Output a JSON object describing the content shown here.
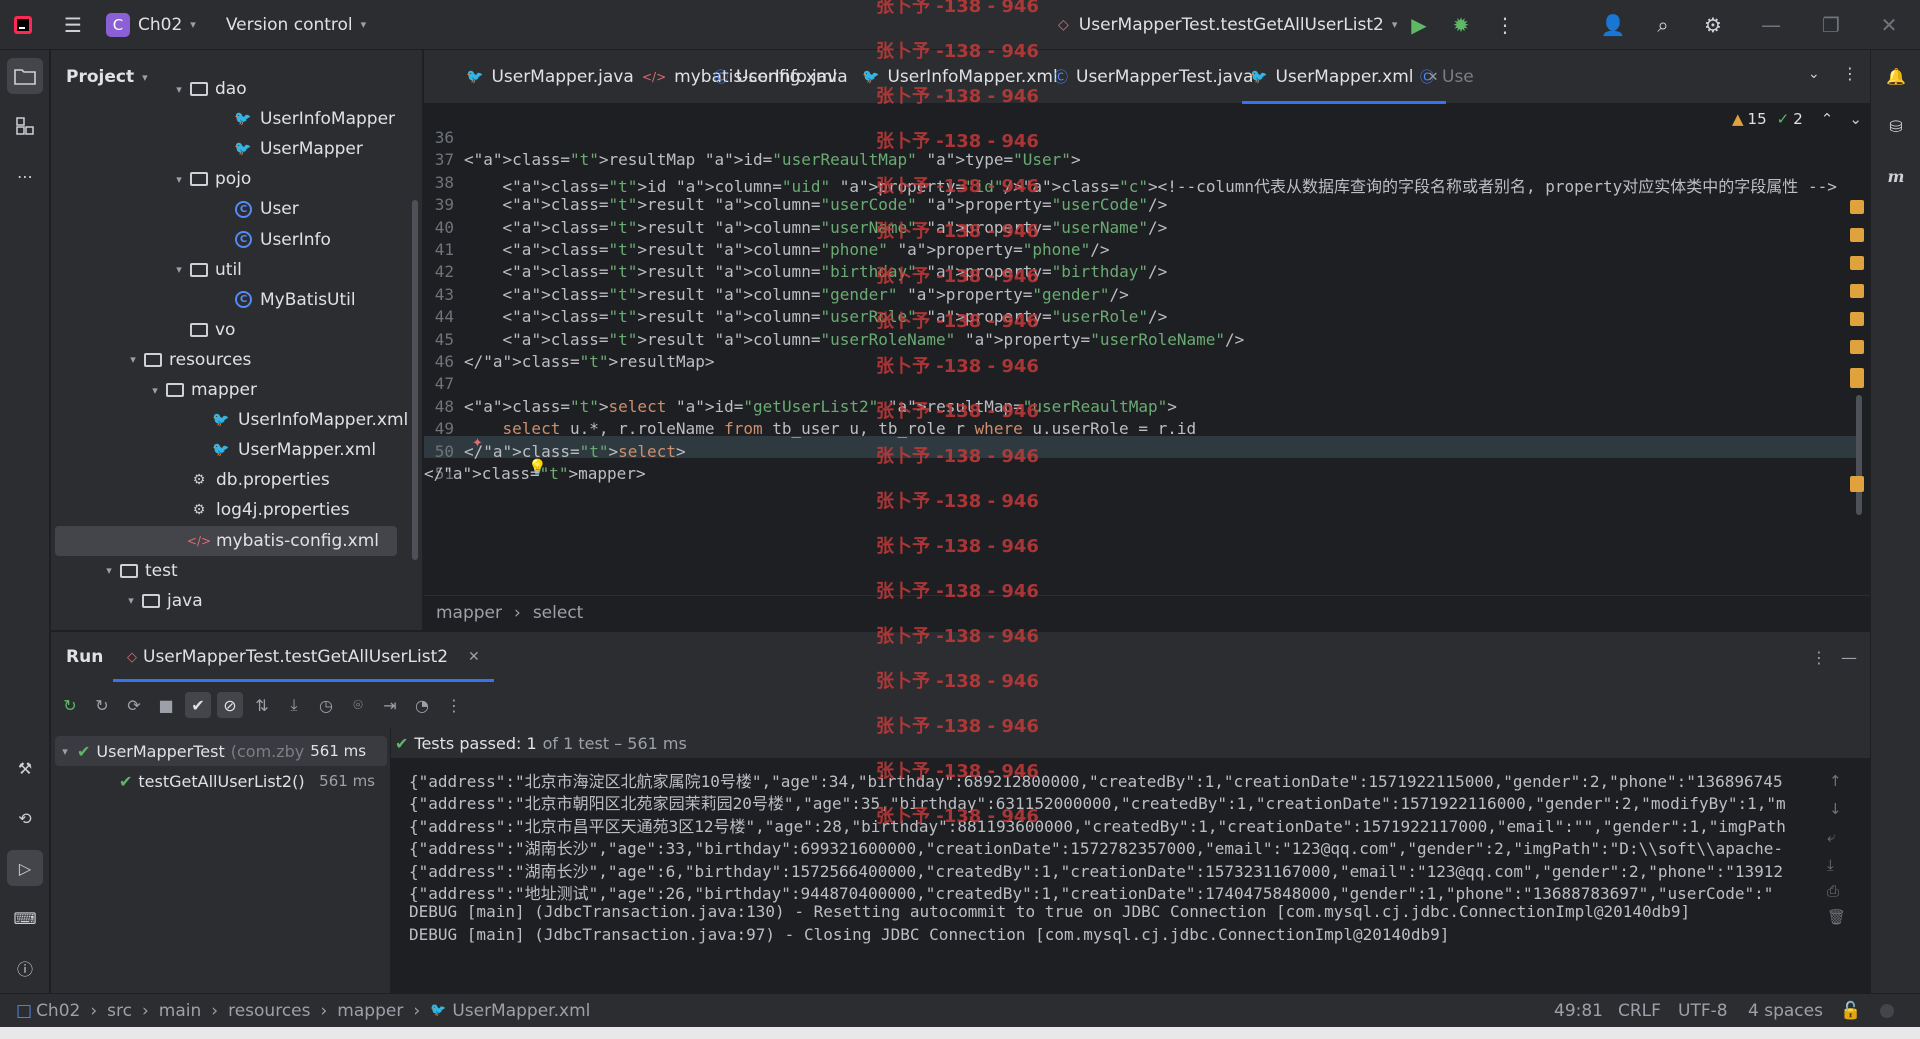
{
  "titlebar": {
    "project_initial": "C",
    "project_name": "Ch02",
    "vcs_label": "Version control",
    "run_config": "UserMapperTest.testGetAllUserList2"
  },
  "project_pane": {
    "title": "Project",
    "items": [
      {
        "label": "dao",
        "type": "package"
      },
      {
        "label": "UserInfoMapper",
        "type": "mapper"
      },
      {
        "label": "UserMapper",
        "type": "mapper"
      },
      {
        "label": "pojo",
        "type": "package"
      },
      {
        "label": "User",
        "type": "class"
      },
      {
        "label": "UserInfo",
        "type": "class"
      },
      {
        "label": "util",
        "type": "package"
      },
      {
        "label": "MyBatisUtil",
        "type": "class"
      },
      {
        "label": "vo",
        "type": "package"
      },
      {
        "label": "resources",
        "type": "folder"
      },
      {
        "label": "mapper",
        "type": "folder"
      },
      {
        "label": "UserInfoMapper.xml",
        "type": "mapper-xml"
      },
      {
        "label": "UserMapper.xml",
        "type": "mapper-xml"
      },
      {
        "label": "db.properties",
        "type": "properties"
      },
      {
        "label": "log4j.properties",
        "type": "properties"
      },
      {
        "label": "mybatis-config.xml",
        "type": "xml",
        "selected": true
      },
      {
        "label": "test",
        "type": "folder"
      },
      {
        "label": "java",
        "type": "folder"
      }
    ]
  },
  "editor": {
    "tabs": [
      {
        "label": "UserMapper.java",
        "icon": "mapper-icon"
      },
      {
        "label": "mybatis-config.xml",
        "icon": "xml-icon"
      },
      {
        "label": "UserInfo.java",
        "icon": "class-icon"
      },
      {
        "label": "UserInfoMapper.xml",
        "icon": "mapper-icon"
      },
      {
        "label": "UserMapperTest.java",
        "icon": "class-icon"
      },
      {
        "label": "UserMapper.xml",
        "icon": "mapper-icon",
        "active": true
      },
      {
        "label": "Use",
        "icon": "class-icon"
      }
    ],
    "warnings": "15",
    "weak_warnings": "2",
    "line_numbers": [
      "36",
      "37",
      "38",
      "39",
      "40",
      "41",
      "42",
      "43",
      "44",
      "45",
      "46",
      "47",
      "48",
      "49",
      "50",
      "51"
    ],
    "lines": [
      "",
      "<resultMap id=\"userReaultMap\" type=\"User\">",
      "    <id column=\"uid\" property=\"id\"/><!--column代表从数据库查询的字段名称或者别名, property对应实体类中的字段属性 -->",
      "    <result column=\"userCode\" property=\"userCode\"/>",
      "    <result column=\"userName\" property=\"userName\"/>",
      "    <result column=\"phone\" property=\"phone\"/>",
      "    <result column=\"birthday\" property=\"birthday\"/>",
      "    <result column=\"gender\" property=\"gender\"/>",
      "    <result column=\"userRole\" property=\"userRole\"/>",
      "    <result column=\"userRoleName\" property=\"userRoleName\"/>",
      "</resultMap>",
      "",
      "<select id=\"getUserList2\" resultMap=\"userReaultMap\">",
      "    select u.*, r.roleName from tb_user u, tb_role r where u.userRole = r.id",
      "</select>",
      "</mapper>"
    ],
    "breadcrumbs": [
      "mapper",
      "select"
    ]
  },
  "run_panel": {
    "title": "Run",
    "tab_label": "UserMapperTest.testGetAllUserList2",
    "tests": [
      {
        "name": "UserMapperTest",
        "pkg": "(com.zby",
        "time": "561 ms"
      },
      {
        "name": "testGetAllUserList2()",
        "pkg": "",
        "time": "561 ms"
      }
    ],
    "summary_bold": "Tests passed: 1",
    "summary_rest": "of 1 test – 561 ms",
    "console": [
      "{\"address\":\"北京市海淀区北航家属院10号楼\",\"age\":34,\"birthday\":689212800000,\"createdBy\":1,\"creationDate\":1571922115000,\"gender\":2,\"phone\":\"136896745",
      "{\"address\":\"北京市朝阳区北苑家园茉莉园20号楼\",\"age\":35,\"birthday\":631152000000,\"createdBy\":1,\"creationDate\":1571922116000,\"gender\":2,\"modifyBy\":1,\"m",
      "{\"address\":\"北京市昌平区天通苑3区12号楼\",\"age\":28,\"birthday\":881193600000,\"createdBy\":1,\"creationDate\":1571922117000,\"email\":\"\",\"gender\":1,\"imgPath",
      "{\"address\":\"湖南长沙\",\"age\":33,\"birthday\":699321600000,\"creationDate\":1572782357000,\"email\":\"123@qq.com\",\"gender\":2,\"imgPath\":\"D:\\\\soft\\\\apache-",
      "{\"address\":\"湖南长沙\",\"age\":6,\"birthday\":1572566400000,\"createdBy\":1,\"creationDate\":1573231167000,\"email\":\"123@qq.com\",\"gender\":2,\"phone\":\"13912",
      "{\"address\":\"地址测试\",\"age\":26,\"birthday\":944870400000,\"createdBy\":1,\"creationDate\":1740475848000,\"gender\":1,\"phone\":\"13688783697\",\"userCode\":\"",
      "DEBUG [main] (JdbcTransaction.java:130) - Resetting autocommit to true on JDBC Connection [com.mysql.cj.jdbc.ConnectionImpl@20140db9]",
      "DEBUG [main] (JdbcTransaction.java:97) - Closing JDBC Connection [com.mysql.cj.jdbc.ConnectionImpl@20140db9]"
    ]
  },
  "statusbar": {
    "path": [
      "Ch02",
      "src",
      "main",
      "resources",
      "mapper",
      "UserMapper.xml"
    ],
    "position": "49:81",
    "line_sep": "CRLF",
    "encoding": "UTF-8",
    "indent": "4 spaces"
  },
  "watermark": "张卜予 -138 - 946"
}
